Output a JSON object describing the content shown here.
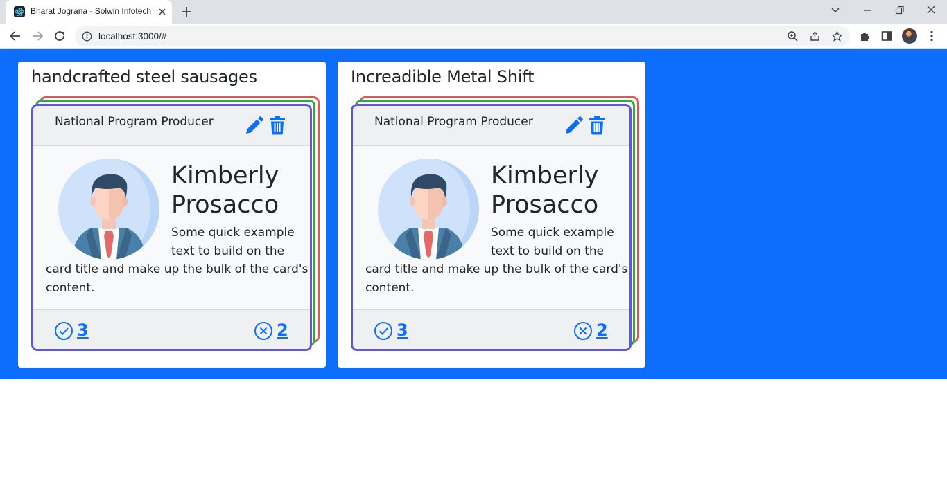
{
  "browser": {
    "tab_title": "Bharat Jograna - Solwin Infotech",
    "url": "localhost:3000/#"
  },
  "boards": [
    {
      "title": "handcrafted steel sausages",
      "card": {
        "role": "National Program Producer",
        "name_line1": "Kimberly",
        "name_line2": "Prosacco",
        "text_line1": "Some quick example",
        "text_line2": "text to build on the",
        "text_line3": "card title and make up the bulk of the card's",
        "text_line4": "content.",
        "upvotes": "3",
        "downvotes": "2"
      }
    },
    {
      "title": "Increadible Metal Shift",
      "card": {
        "role": "National Program Producer",
        "name_line1": "Kimberly",
        "name_line2": "Prosacco",
        "text_line1": "Some quick example",
        "text_line2": "text to build on the",
        "text_line3": "card title and make up the bulk of the card's",
        "text_line4": "content.",
        "upvotes": "3",
        "downvotes": "2"
      }
    }
  ],
  "colors": {
    "page_background": "#0d6efd",
    "card_border": "#6155e8",
    "stack_green": "#2eaa3d",
    "stack_red": "#e25555",
    "action_blue": "#0d6efd"
  }
}
